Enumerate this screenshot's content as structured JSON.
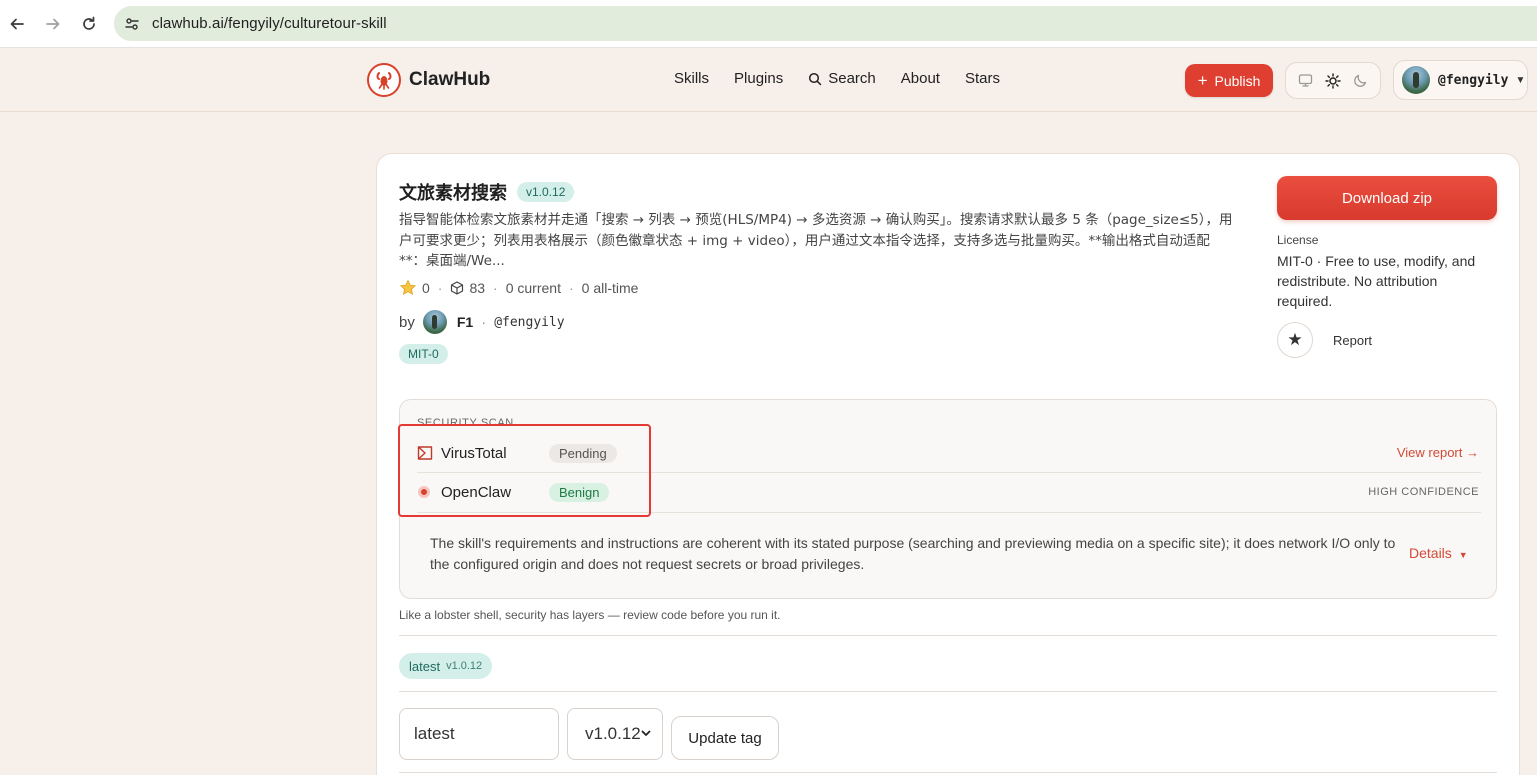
{
  "browser": {
    "url": "clawhub.ai/fengyily/culturetour-skill"
  },
  "header": {
    "brand": "ClawHub",
    "nav": [
      "Skills",
      "Plugins",
      "Search",
      "About",
      "Stars"
    ],
    "publish_label": "Publish",
    "user_handle": "@fengyily"
  },
  "skill": {
    "title": "文旅素材搜索",
    "version": "v1.0.12",
    "description": "指导智能体检索文旅素材并走通「搜索 → 列表 → 预览(HLS/MP4) → 多选资源 → 确认购买」。搜索请求默认最多 5 条（page_size≤5），用户可要求更少；列表用表格展示（颜色徽章状态 + img + video），用户通过文本指令选择，支持多选与批量购买。**输出格式自动适配**：桌面端/We...",
    "stars": "0",
    "installs": "83",
    "current": "0 current",
    "all_time": "0 all-time",
    "by_label": "by",
    "author_name": "F1",
    "author_handle": "@fengyily",
    "license_badge": "MIT-0"
  },
  "sidebar": {
    "download_label": "Download zip",
    "license_label": "License",
    "license_text": "MIT-0 · Free to use, modify, and redistribute. No attribution required.",
    "report_label": "Report"
  },
  "security": {
    "heading": "SECURITY SCAN",
    "scanners": [
      {
        "name": "VirusTotal",
        "status": "Pending"
      },
      {
        "name": "OpenClaw",
        "status": "Benign"
      }
    ],
    "view_report": "View report →",
    "confidence": "HIGH CONFIDENCE",
    "summary": "The skill's requirements and instructions are coherent with its stated purpose (searching and previewing media on a specific site); it does network I/O only to the configured origin and does not request secrets or broad privileges.",
    "details_label": "Details",
    "tagline": "Like a lobster shell, security has layers — review code before you run it."
  },
  "tags": {
    "tag_name": "latest",
    "tag_version": "v1.0.12",
    "input_value": "latest",
    "selected_version": "v1.0.12",
    "update_label": "Update tag"
  },
  "colors": {
    "accent": "#de3f31",
    "teal_badge": "#d4efe9",
    "benign_badge": "#d8f1e3",
    "highlight": "#e53935"
  }
}
